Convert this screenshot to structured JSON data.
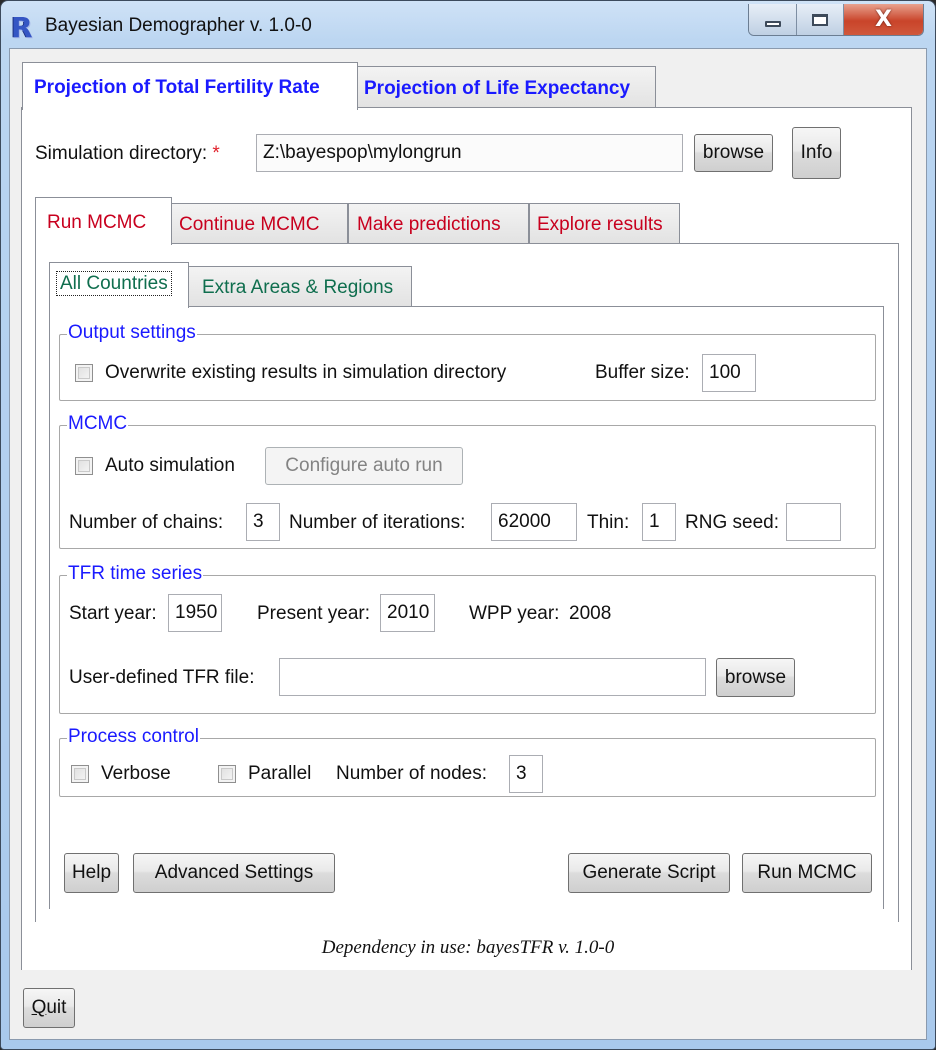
{
  "window": {
    "title": "Bayesian Demographer  v. 1.0-0",
    "app_icon": "r-logo-icon",
    "controls": {
      "minimize": "minimize-icon",
      "maximize": "maximize-icon",
      "close": "close-icon",
      "close_glyph": "X"
    }
  },
  "main_tabs": [
    {
      "label": "Projection of Total Fertility Rate",
      "active": true
    },
    {
      "label": "Projection of Life Expectancy",
      "active": false
    }
  ],
  "simulation_directory": {
    "label": "Simulation directory:",
    "required_marker": "*",
    "value": "Z:\\bayespop\\mylongrun",
    "browse_label": "browse",
    "info_label": "Info"
  },
  "sub_tabs": [
    {
      "label": "Run MCMC",
      "active": true
    },
    {
      "label": "Continue MCMC",
      "active": false
    },
    {
      "label": "Make predictions",
      "active": false
    },
    {
      "label": "Explore results",
      "active": false
    }
  ],
  "region_tabs": [
    {
      "label": "All Countries",
      "active": true
    },
    {
      "label": "Extra Areas & Regions",
      "active": false
    }
  ],
  "output_settings": {
    "legend": "Output settings",
    "overwrite_label": "Overwrite existing results in simulation directory",
    "overwrite_checked": false,
    "buffer_label": "Buffer size:",
    "buffer_value": "100"
  },
  "mcmc": {
    "legend": "MCMC",
    "auto_label": "Auto simulation",
    "auto_checked": false,
    "configure_label": "Configure auto run",
    "chains_label": "Number of chains:",
    "chains_value": "3",
    "iterations_label": "Number of iterations:",
    "iterations_value": "62000",
    "thin_label": "Thin:",
    "thin_value": "1",
    "seed_label": "RNG seed:",
    "seed_value": ""
  },
  "tfr_series": {
    "legend": "TFR time series",
    "start_label": "Start year:",
    "start_value": "1950",
    "present_label": "Present year:",
    "present_value": "2010",
    "wpp_label": "WPP year:",
    "wpp_value": "2008",
    "file_label": "User-defined TFR file:",
    "file_value": "",
    "browse_label": "browse"
  },
  "process_control": {
    "legend": "Process control",
    "verbose_label": "Verbose",
    "verbose_checked": false,
    "parallel_label": "Parallel",
    "parallel_checked": false,
    "nodes_label": "Number of nodes:",
    "nodes_value": "3"
  },
  "actions": {
    "help": "Help",
    "advanced": "Advanced Settings",
    "generate_script": "Generate Script",
    "run_mcmc": "Run MCMC"
  },
  "dependency_text": "Dependency in use: bayesTFR  v. 1.0-0",
  "quit": {
    "label_first": "Q",
    "label_rest": "uit"
  }
}
